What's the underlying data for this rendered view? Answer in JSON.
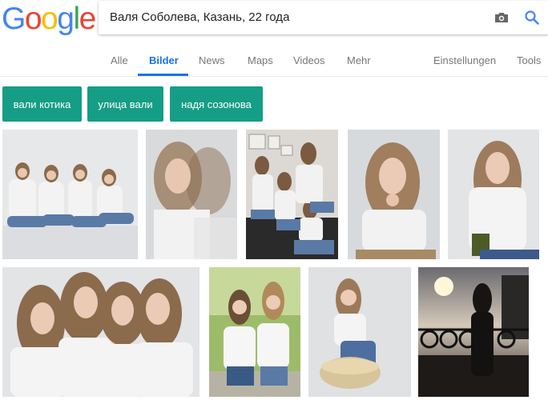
{
  "logo": {
    "letters": [
      "G",
      "o",
      "o",
      "g",
      "l",
      "e"
    ],
    "colors": [
      "#4285f4",
      "#ea4335",
      "#fbbc05",
      "#4285f4",
      "#34a853",
      "#ea4335"
    ]
  },
  "search": {
    "query": "Валя Соболева, Казань, 22 года",
    "camera_icon": "camera-icon",
    "search_icon": "search-icon",
    "accent": "#4285f4"
  },
  "tabs": {
    "items": [
      {
        "label": "Alle"
      },
      {
        "label": "Bilder"
      },
      {
        "label": "News"
      },
      {
        "label": "Maps"
      },
      {
        "label": "Videos"
      },
      {
        "label": "Mehr"
      }
    ],
    "settings": "Einstellungen",
    "tools": "Tools",
    "active_color": "#1a73e8"
  },
  "related": {
    "chips": [
      "вали котика",
      "улица вали",
      "надя созонова"
    ],
    "chip_color": "#159d86"
  },
  "results": {
    "row1": [
      "image-four-girls-sitting",
      "image-girl-portrait-overlay",
      "image-three-girls-sofa",
      "image-girl-hand-chin",
      "image-girl-with-candle"
    ],
    "row2": [
      "image-four-girls-closeup",
      "image-two-girls-park",
      "image-girl-on-pouf",
      "image-girl-sunset-railing"
    ]
  }
}
